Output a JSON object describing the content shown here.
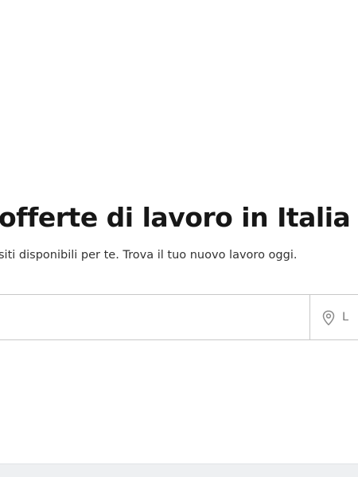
{
  "hero": {
    "title": "offerte di lavoro in Italia",
    "subtitle": "siti disponibili per te. Trova il tuo nuovo lavoro oggi."
  },
  "search": {
    "keyword_value": "",
    "location_placeholder": "L",
    "location_icon": "map-pin-icon"
  }
}
